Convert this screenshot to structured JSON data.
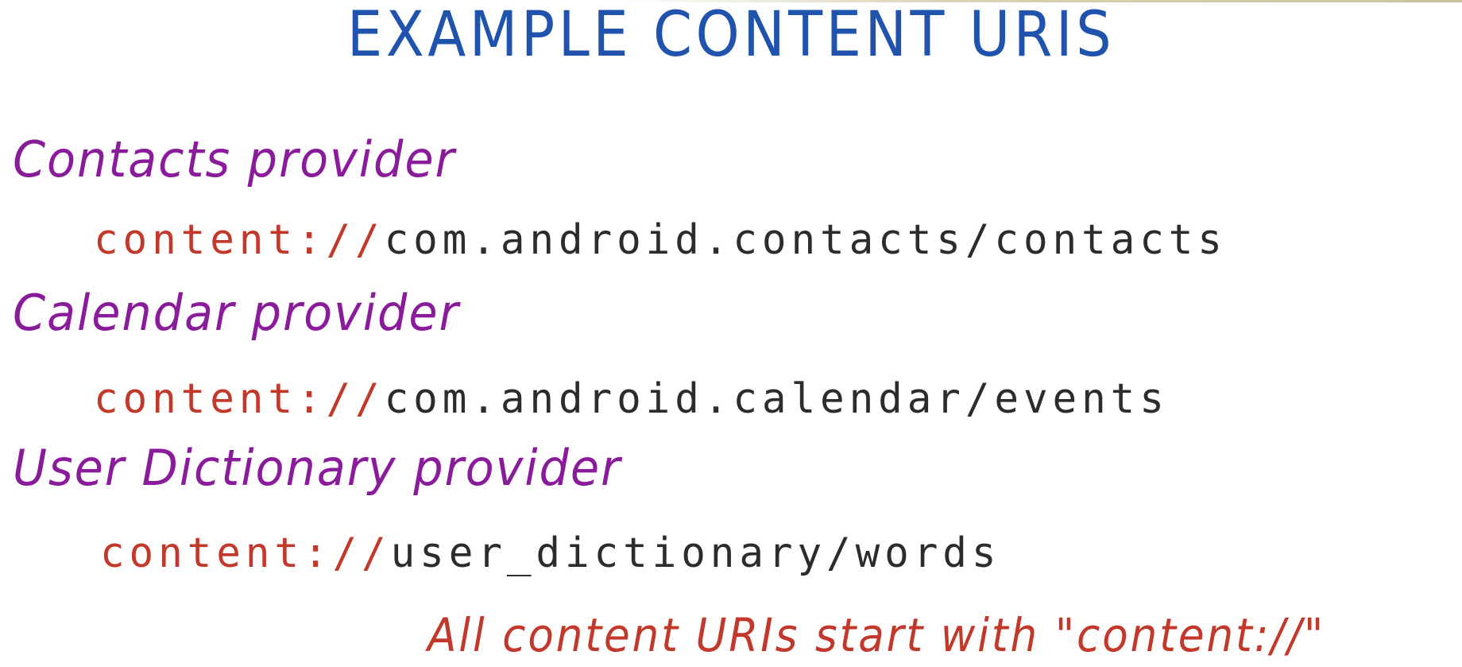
{
  "title": "EXAMPLE CONTENT URIS",
  "providers": [
    {
      "name": "Contacts provider",
      "uri_scheme": "content://",
      "uri_path": "com.android.contacts/contacts"
    },
    {
      "name": "Calendar provider",
      "uri_scheme": "content://",
      "uri_path": "com.android.calendar/events"
    },
    {
      "name": "User Dictionary provider",
      "uri_scheme": "content://",
      "uri_path": "user_dictionary/words"
    }
  ],
  "note": "All content URIs start with \"content://\"",
  "colors": {
    "title": "#1f53ad",
    "provider": "#8a1c9c",
    "scheme": "#c2382a",
    "path": "#2c2c2c",
    "note": "#c2382a"
  }
}
